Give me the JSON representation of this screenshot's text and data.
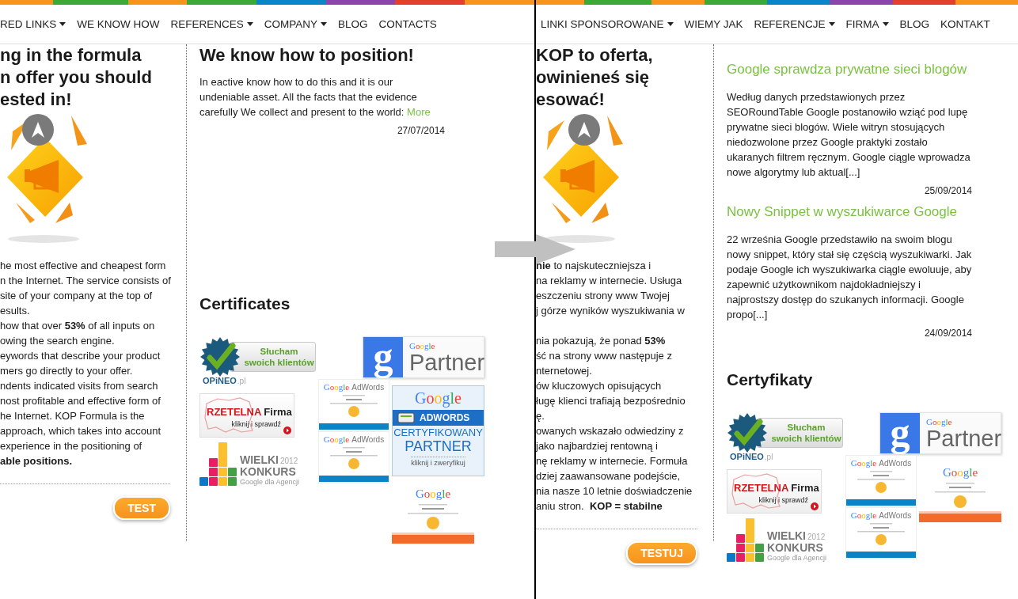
{
  "panels": [
    {
      "nav": [
        {
          "label": "RED LINKS",
          "dropdown": true
        },
        {
          "label": "WE KNOW HOW",
          "dropdown": false
        },
        {
          "label": "REFERENCES",
          "dropdown": true
        },
        {
          "label": "COMPANY",
          "dropdown": true
        },
        {
          "label": "BLOG",
          "dropdown": false
        },
        {
          "label": "CONTACTS",
          "dropdown": false
        }
      ],
      "intro": {
        "heading": [
          "ng in the formula",
          "n offer you should",
          "ested in!"
        ],
        "paragraphs": [
          [
            "he most effective and cheapest form",
            "n the Internet. The service consists of",
            "site of your company at the top of",
            "esults.",
            "how that over **53%** of all inputs on",
            "owing the search engine.",
            "eywords that describe your product",
            "mers go directly to your offer.",
            "ndents indicated visits from search",
            "nost profitable and effective form of",
            "he Internet. KOP Formula is the",
            "approach, which takes into account",
            "experience in the positioning of",
            "**able positions.**"
          ]
        ],
        "button": "TEST"
      },
      "aside": {
        "heading": "We know how to position!",
        "posts": [
          {
            "body": "In eactive know how to do this and it is our undeniable asset. All the facts that the evidence carefully We collect and present to the world:",
            "link": "More",
            "date": "27/07/2014"
          }
        ],
        "certificates": {
          "heading": "Certificates",
          "badges": [
            {
              "kind": "review",
              "lines": [
                "Słucham",
                "swoich klientów"
              ],
              "brand": "OPiNEO",
              "suffix": ".pl"
            },
            {
              "kind": "partner",
              "mark": "g",
              "brand": "Google",
              "label": "Partner"
            },
            {
              "kind": "company",
              "words": [
                "RZETELNA",
                "Firma"
              ],
              "caption": "kliknij i sprawdź"
            },
            {
              "kind": "certificate",
              "brand": "Google",
              "product": "AdWords"
            },
            {
              "kind": "certified-partner",
              "brand": "Google",
              "band": "ADWORDS",
              "lines": [
                "CERTYFIKOWANY",
                "PARTNER"
              ],
              "caption": "kliknij i zweryfikuj"
            },
            {
              "kind": "contest",
              "title": "WIELKI",
              "year": "2012",
              "title2": "KONKURS",
              "caption": "Google dla Agencji"
            },
            {
              "kind": "certificate",
              "brand": "Google",
              "product": "AdWords"
            },
            {
              "kind": "analytics",
              "brand": "Google"
            }
          ]
        }
      }
    },
    {
      "nav": [
        {
          "label": "LINKI SPONSOROWANE",
          "dropdown": true
        },
        {
          "label": "WIEMY JAK",
          "dropdown": false
        },
        {
          "label": "REFERENCJE",
          "dropdown": true
        },
        {
          "label": "FIRMA",
          "dropdown": true
        },
        {
          "label": "BLOG",
          "dropdown": false
        },
        {
          "label": "KONTAKT",
          "dropdown": false
        }
      ],
      "intro": {
        "heading": [
          "KOP to oferta,",
          "owinieneś się",
          "esować!"
        ],
        "paragraphs": [
          [
            "**nie** to najskuteczniejsza i",
            "na reklamy w internecie. Usługa",
            "eszczeniu strony www Twojej",
            "j górze wyników wyszukiwania w"
          ],
          [
            "nia pokazują, że ponad **53%**",
            "ść na strony www następuje z",
            "nternetowej.",
            "ów kluczowych opisujących",
            "ługę klienci trafiają bezpośrednio",
            "ę.",
            "owanych wskazało odwiedziny z",
            "jako najbardziej rentowną i",
            "nę reklamy w internecie. Formuła",
            "dziej zaawansowane podejście,",
            "nia nasze 10 letnie doświadczenie",
            "aniu stron.  **KOP = stabilne**"
          ]
        ],
        "button": "TESTUJ"
      },
      "aside": {
        "posts": [
          {
            "title": "Google sprawdza prywatne sieci blogów",
            "body": "Według danych przedstawionych przez SEORoundTable Google postanowiło wziąć pod lupę prywatne sieci blogów. Wiele witryn stosujących niedozwolone przez Google praktyki zostało ukaranych filtrem ręcznym. Google ciągle wprowadza nowe algorytmy lub aktual[...]",
            "date": "25/09/2014"
          },
          {
            "title": "Nowy Snippet w wyszukiwarce Google",
            "body": "22 września Google przedstawiło na swoim blogu nowy snippet, który stał się częścią wyszukiwarki. Jak podaje Google ich wyszukiwarka ciągle ewoluuje, aby zapewnić użytkownikom najdokładniejszy i najprostszy dostęp do szukanych informacji. Google propo[...]",
            "date": "24/09/2014"
          }
        ],
        "certificates": {
          "heading": "Certyfikaty",
          "badges": [
            {
              "kind": "review",
              "lines": [
                "Słucham",
                "swoich klientów"
              ],
              "brand": "OPiNEO",
              "suffix": ".pl"
            },
            {
              "kind": "partner",
              "mark": "g",
              "brand": "Google",
              "label": "Partner"
            },
            {
              "kind": "company",
              "words": [
                "RZETELNA",
                "Firma"
              ],
              "caption": "kliknij i sprawdź"
            },
            {
              "kind": "certificate",
              "brand": "Google",
              "product": "AdWords"
            },
            {
              "kind": "analytics",
              "brand": "Google"
            },
            {
              "kind": "contest",
              "title": "WIELKI",
              "year": "2012",
              "title2": "KONKURS",
              "caption": "Google dla Agencji"
            },
            {
              "kind": "certificate",
              "brand": "Google",
              "product": "AdWords"
            }
          ]
        }
      }
    }
  ]
}
